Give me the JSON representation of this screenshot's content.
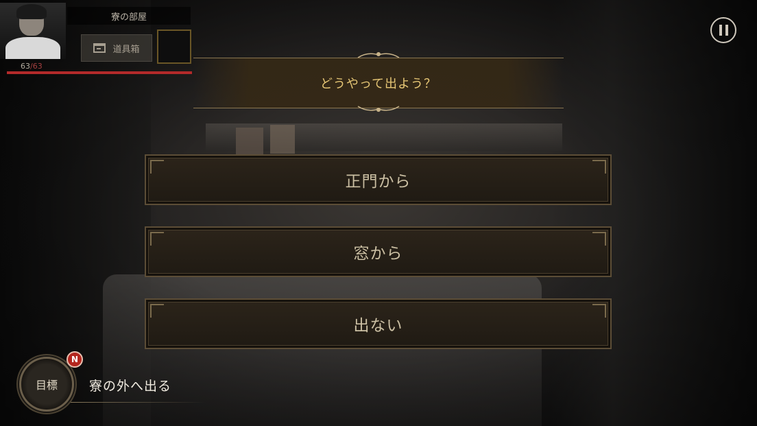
{
  "hud": {
    "room_name": "寮の部屋",
    "toolbox_label": "道具箱",
    "hp_current": "63",
    "hp_separator": "/",
    "hp_max": "63",
    "hp_fraction": 1.0
  },
  "dialog": {
    "question": "どうやって出よう？",
    "choices": [
      {
        "label": "正門から"
      },
      {
        "label": "窓から"
      },
      {
        "label": "出ない"
      }
    ]
  },
  "objective": {
    "button_label": "目標",
    "badge": "N",
    "text": "寮の外へ出る"
  },
  "icons": {
    "pause": "pause-icon",
    "toolbox": "toolbox-icon"
  },
  "colors": {
    "question_text": "#e6c675",
    "hp_bar": "#b32a2a",
    "badge": "#b3261e"
  }
}
